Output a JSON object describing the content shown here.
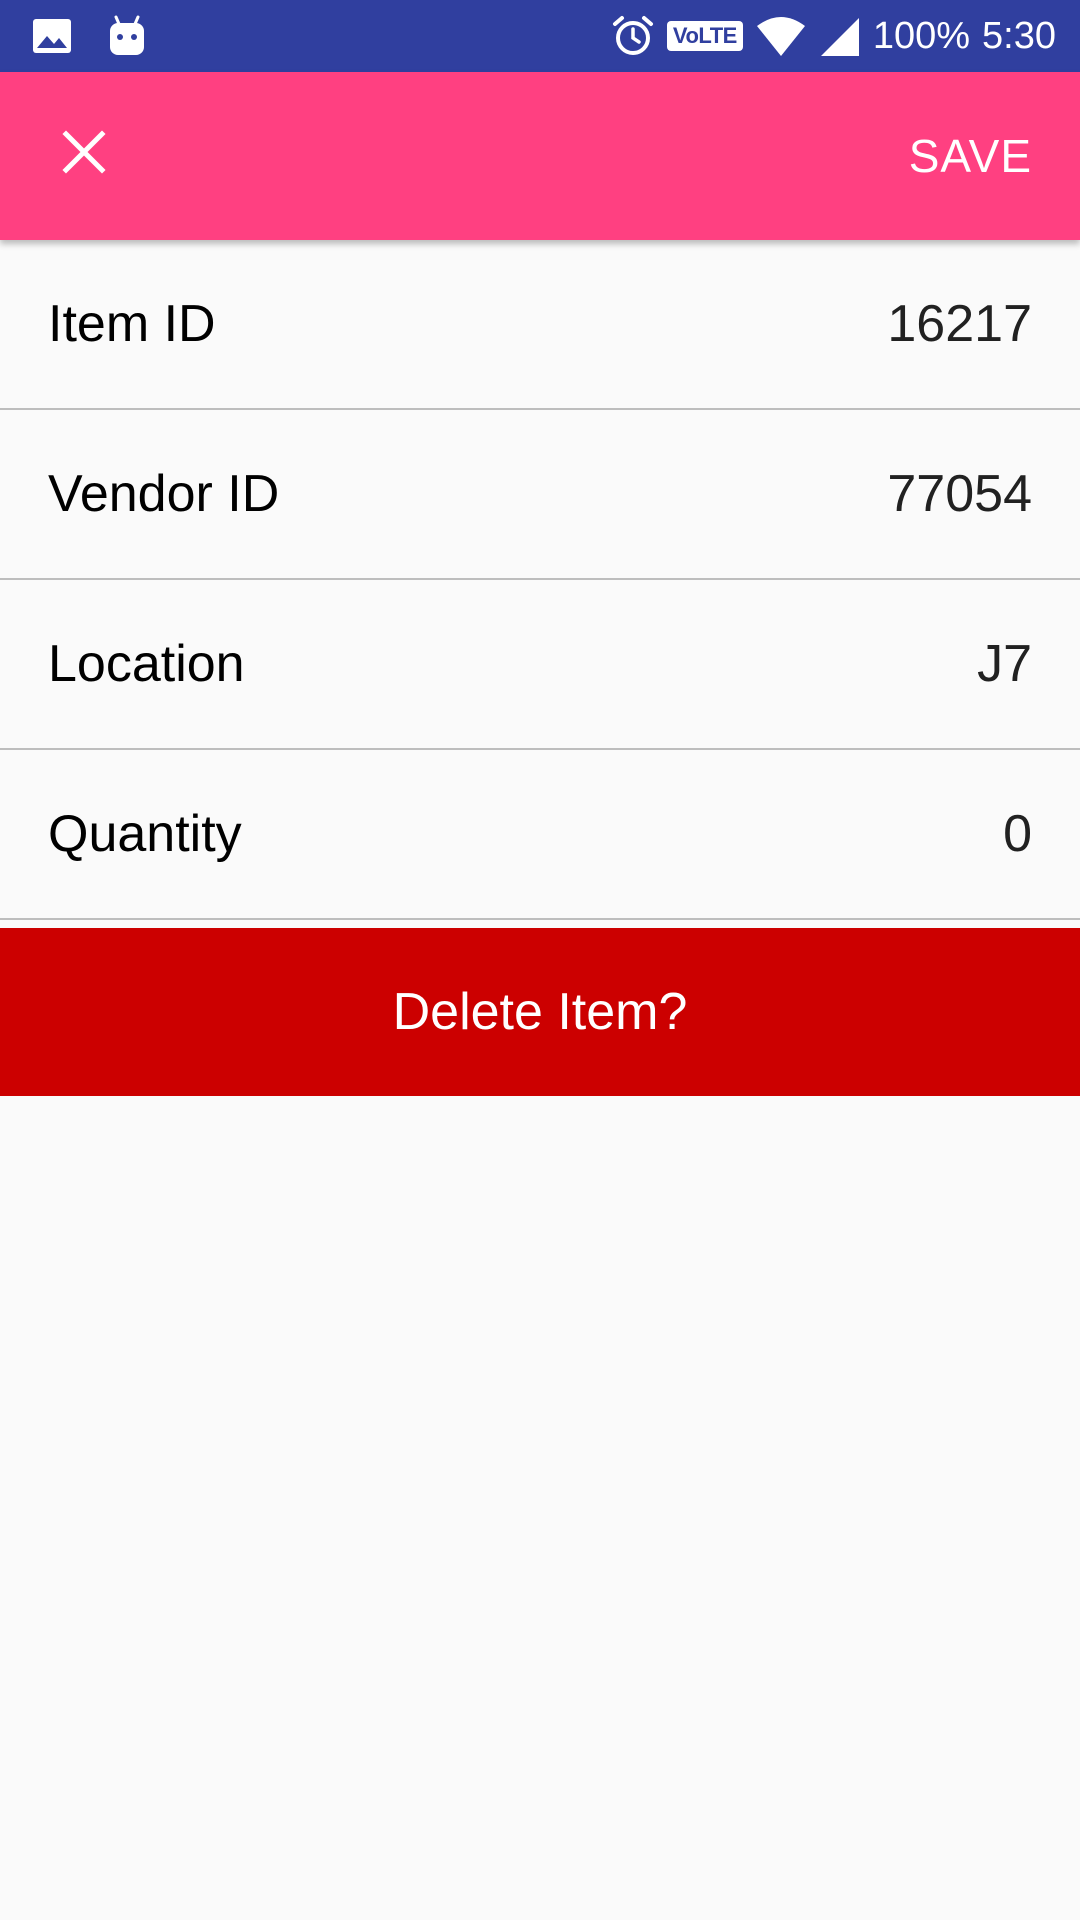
{
  "status_bar": {
    "icons": [
      "image-icon",
      "android-icon",
      "alarm-icon",
      "volte-badge",
      "wifi-icon",
      "cell-signal-icon"
    ],
    "volte": "VoLTE",
    "battery": "100%",
    "time": "5:30"
  },
  "app_bar": {
    "close_icon": "close-icon",
    "save_label": "SAVE",
    "color": "#ff4081"
  },
  "fields": [
    {
      "label": "Item ID",
      "value": "16217"
    },
    {
      "label": "Vendor ID",
      "value": "77054"
    },
    {
      "label": "Location",
      "value": "J7"
    },
    {
      "label": "Quantity",
      "value": "0"
    }
  ],
  "delete_button": {
    "label": "Delete Item?",
    "color": "#cc0000"
  },
  "colors": {
    "status_bar": "#303f9f",
    "accent": "#ff4081",
    "danger": "#cc0000",
    "background": "#fafafa"
  }
}
